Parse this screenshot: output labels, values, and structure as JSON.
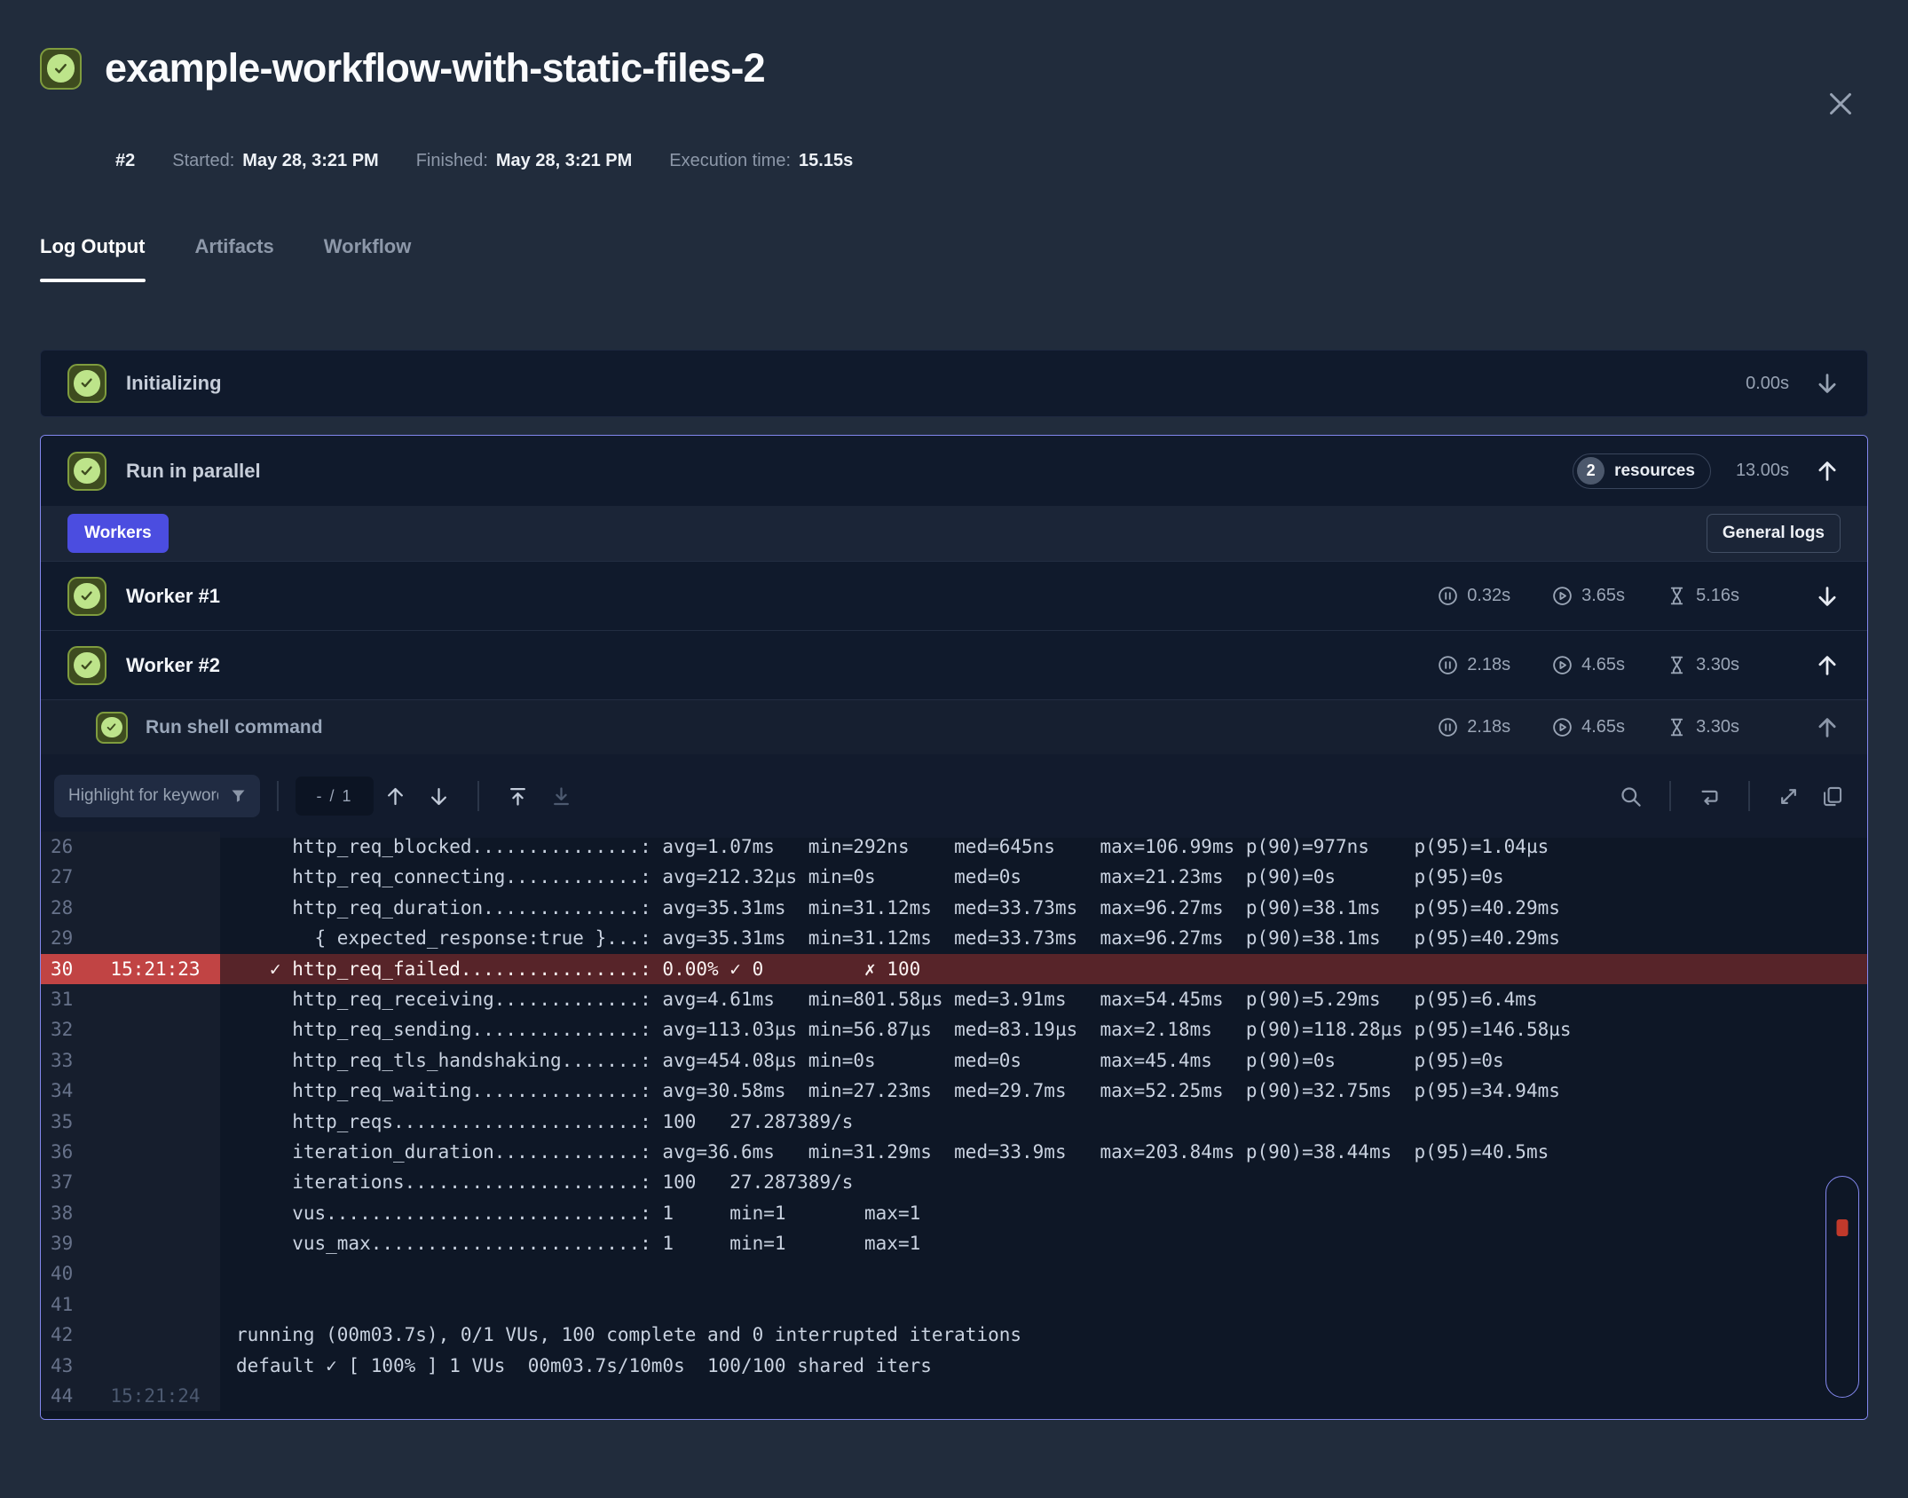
{
  "window": {
    "title": "example-workflow-with-static-files-2",
    "run_number": "#2",
    "started_label": "Started:",
    "started_value": "May 28, 3:21 PM",
    "finished_label": "Finished:",
    "finished_value": "May 28, 3:21 PM",
    "execution_label": "Execution time:",
    "execution_value": "15.15s"
  },
  "tabs": [
    {
      "label": "Log Output",
      "active": true
    },
    {
      "label": "Artifacts",
      "active": false
    },
    {
      "label": "Workflow",
      "active": false
    }
  ],
  "initializing": {
    "label": "Initializing",
    "duration": "0.00s",
    "status": "success",
    "expanded": false
  },
  "run_in_parallel": {
    "label": "Run in parallel",
    "status": "success",
    "resources_count": "2",
    "resources_label": "resources",
    "duration": "13.00s",
    "workers_tab_label": "Workers",
    "general_logs_label": "General logs",
    "workers": [
      {
        "label": "Worker #1",
        "status": "success",
        "paused": "0.32s",
        "running": "3.65s",
        "duration": "5.16s",
        "expanded": false
      },
      {
        "label": "Worker #2",
        "status": "success",
        "paused": "2.18s",
        "running": "4.65s",
        "duration": "3.30s",
        "expanded": true
      }
    ],
    "subtask": {
      "label": "Run shell command",
      "status": "success",
      "paused": "2.18s",
      "running": "4.65s",
      "duration": "3.30s",
      "expanded": true
    }
  },
  "log_viewer": {
    "keyword_input_placeholder": "Highlight for keywords",
    "match_counter": "- / 1",
    "lines": [
      {
        "n": 26,
        "time": "",
        "text": "     http_req_blocked...............: avg=1.07ms   min=292ns    med=645ns    max=106.99ms p(90)=977ns    p(95)=1.04µs"
      },
      {
        "n": 27,
        "time": "",
        "text": "     http_req_connecting............: avg=212.32µs min=0s       med=0s       max=21.23ms  p(90)=0s       p(95)=0s"
      },
      {
        "n": 28,
        "time": "",
        "text": "     http_req_duration..............: avg=35.31ms  min=31.12ms  med=33.73ms  max=96.27ms  p(90)=38.1ms   p(95)=40.29ms"
      },
      {
        "n": 29,
        "time": "",
        "text": "       { expected_response:true }...: avg=35.31ms  min=31.12ms  med=33.73ms  max=96.27ms  p(90)=38.1ms   p(95)=40.29ms"
      },
      {
        "n": 30,
        "time": "15:21:23",
        "text": "   ✓ http_req_failed................: 0.00% ✓ 0         ✗ 100",
        "error": true
      },
      {
        "n": 31,
        "time": "",
        "text": "     http_req_receiving.............: avg=4.61ms   min=801.58µs med=3.91ms   max=54.45ms  p(90)=5.29ms   p(95)=6.4ms"
      },
      {
        "n": 32,
        "time": "",
        "text": "     http_req_sending...............: avg=113.03µs min=56.87µs  med=83.19µs  max=2.18ms   p(90)=118.28µs p(95)=146.58µs"
      },
      {
        "n": 33,
        "time": "",
        "text": "     http_req_tls_handshaking.......: avg=454.08µs min=0s       med=0s       max=45.4ms   p(90)=0s       p(95)=0s"
      },
      {
        "n": 34,
        "time": "",
        "text": "     http_req_waiting...............: avg=30.58ms  min=27.23ms  med=29.7ms   max=52.25ms  p(90)=32.75ms  p(95)=34.94ms"
      },
      {
        "n": 35,
        "time": "",
        "text": "     http_reqs......................: 100   27.287389/s"
      },
      {
        "n": 36,
        "time": "",
        "text": "     iteration_duration.............: avg=36.6ms   min=31.29ms  med=33.9ms   max=203.84ms p(90)=38.44ms  p(95)=40.5ms"
      },
      {
        "n": 37,
        "time": "",
        "text": "     iterations.....................: 100   27.287389/s"
      },
      {
        "n": 38,
        "time": "",
        "text": "     vus............................: 1     min=1       max=1"
      },
      {
        "n": 39,
        "time": "",
        "text": "     vus_max........................: 1     min=1       max=1"
      },
      {
        "n": 40,
        "time": "",
        "text": ""
      },
      {
        "n": 41,
        "time": "",
        "text": ""
      },
      {
        "n": 42,
        "time": "",
        "text": "running (00m03.7s), 0/1 VUs, 100 complete and 0 interrupted iterations"
      },
      {
        "n": 43,
        "time": "",
        "text": "default ✓ [ 100% ] 1 VUs  00m03.7s/10m0s  100/100 shared iters"
      },
      {
        "n": 44,
        "time": "15:21:24",
        "text": ""
      }
    ]
  },
  "colors": {
    "accent_purple": "#8388ef",
    "indigo_button": "#4b4de0",
    "success_green": "#bde48a",
    "error_row_bg": "#572429",
    "error_gutter_bg": "#c14444",
    "error_marker": "#c0392b"
  }
}
